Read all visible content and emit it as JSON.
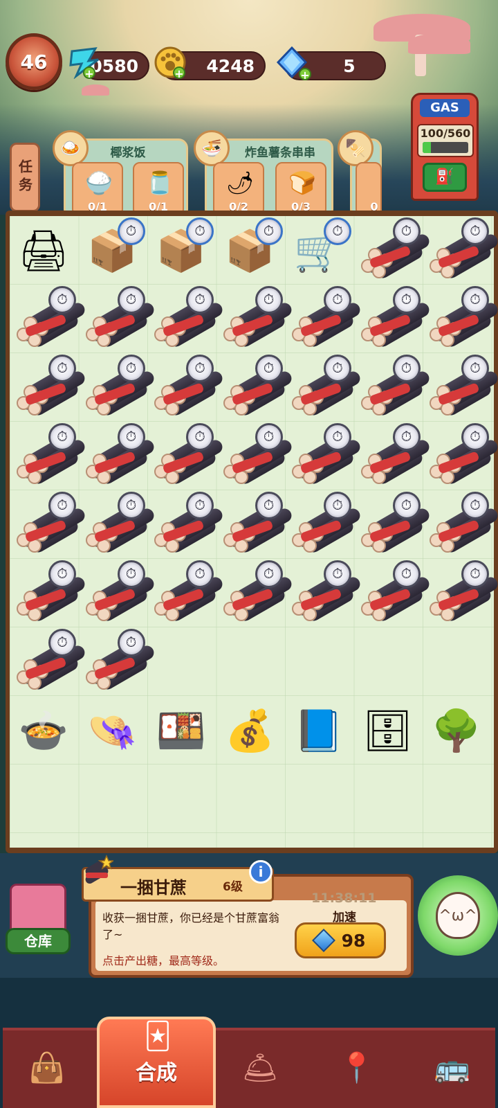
{
  "header": {
    "level": "46",
    "energy": "10580",
    "paws": "4248",
    "gems": "5"
  },
  "gas": {
    "label": "GAS",
    "value": "100/560",
    "fill_fraction": 0.18,
    "button_icon": "fuel-can-icon"
  },
  "tasks": {
    "tab_label": "任务",
    "cards": [
      {
        "title": "椰浆饭",
        "icon": "rice-dish-icon",
        "requirements": [
          {
            "icon": "rice-plate-icon",
            "count": "0/1"
          },
          {
            "icon": "sauce-jar-icon",
            "count": "0/1"
          }
        ]
      },
      {
        "title": "炸鱼薯条串串",
        "icon": "fried-noodle-icon",
        "requirements": [
          {
            "icon": "chili-bottle-icon",
            "count": "0/2"
          },
          {
            "icon": "bread-icon",
            "count": "0/3"
          }
        ]
      },
      {
        "title": "",
        "icon": "skewer-icon",
        "requirements": [
          {
            "icon": "skewer-icon",
            "count": "0"
          }
        ]
      }
    ]
  },
  "board": {
    "row0": [
      "printer",
      "drone-box",
      "drone-box",
      "drone-box",
      "hand-truck",
      "cane",
      "cane"
    ],
    "full_cane_rows": 5,
    "row6_canes": 2,
    "tools": [
      "hotpot-stove-icon",
      "straw-hat-icon",
      "food-cabinet-icon",
      "treasure-chest-icon",
      "spell-book-icon",
      "vending-fridge-icon",
      "flower-tree-icon"
    ]
  },
  "info": {
    "title": "一捆甘蔗",
    "level": "6级",
    "description": "收获一捆甘蔗，你已经是个甘蔗富翁了~",
    "tip": "点击产出糖，最高等级。",
    "timer": "11:38:11",
    "speed_label": "加速",
    "speed_cost": "98",
    "warehouse_label": "仓库",
    "info_icon": "i"
  },
  "nav": {
    "active_label": "合成",
    "items": [
      "bag-icon",
      "merge-icon",
      "cloche-icon",
      "map-pin-icon",
      "bus-icon"
    ]
  }
}
